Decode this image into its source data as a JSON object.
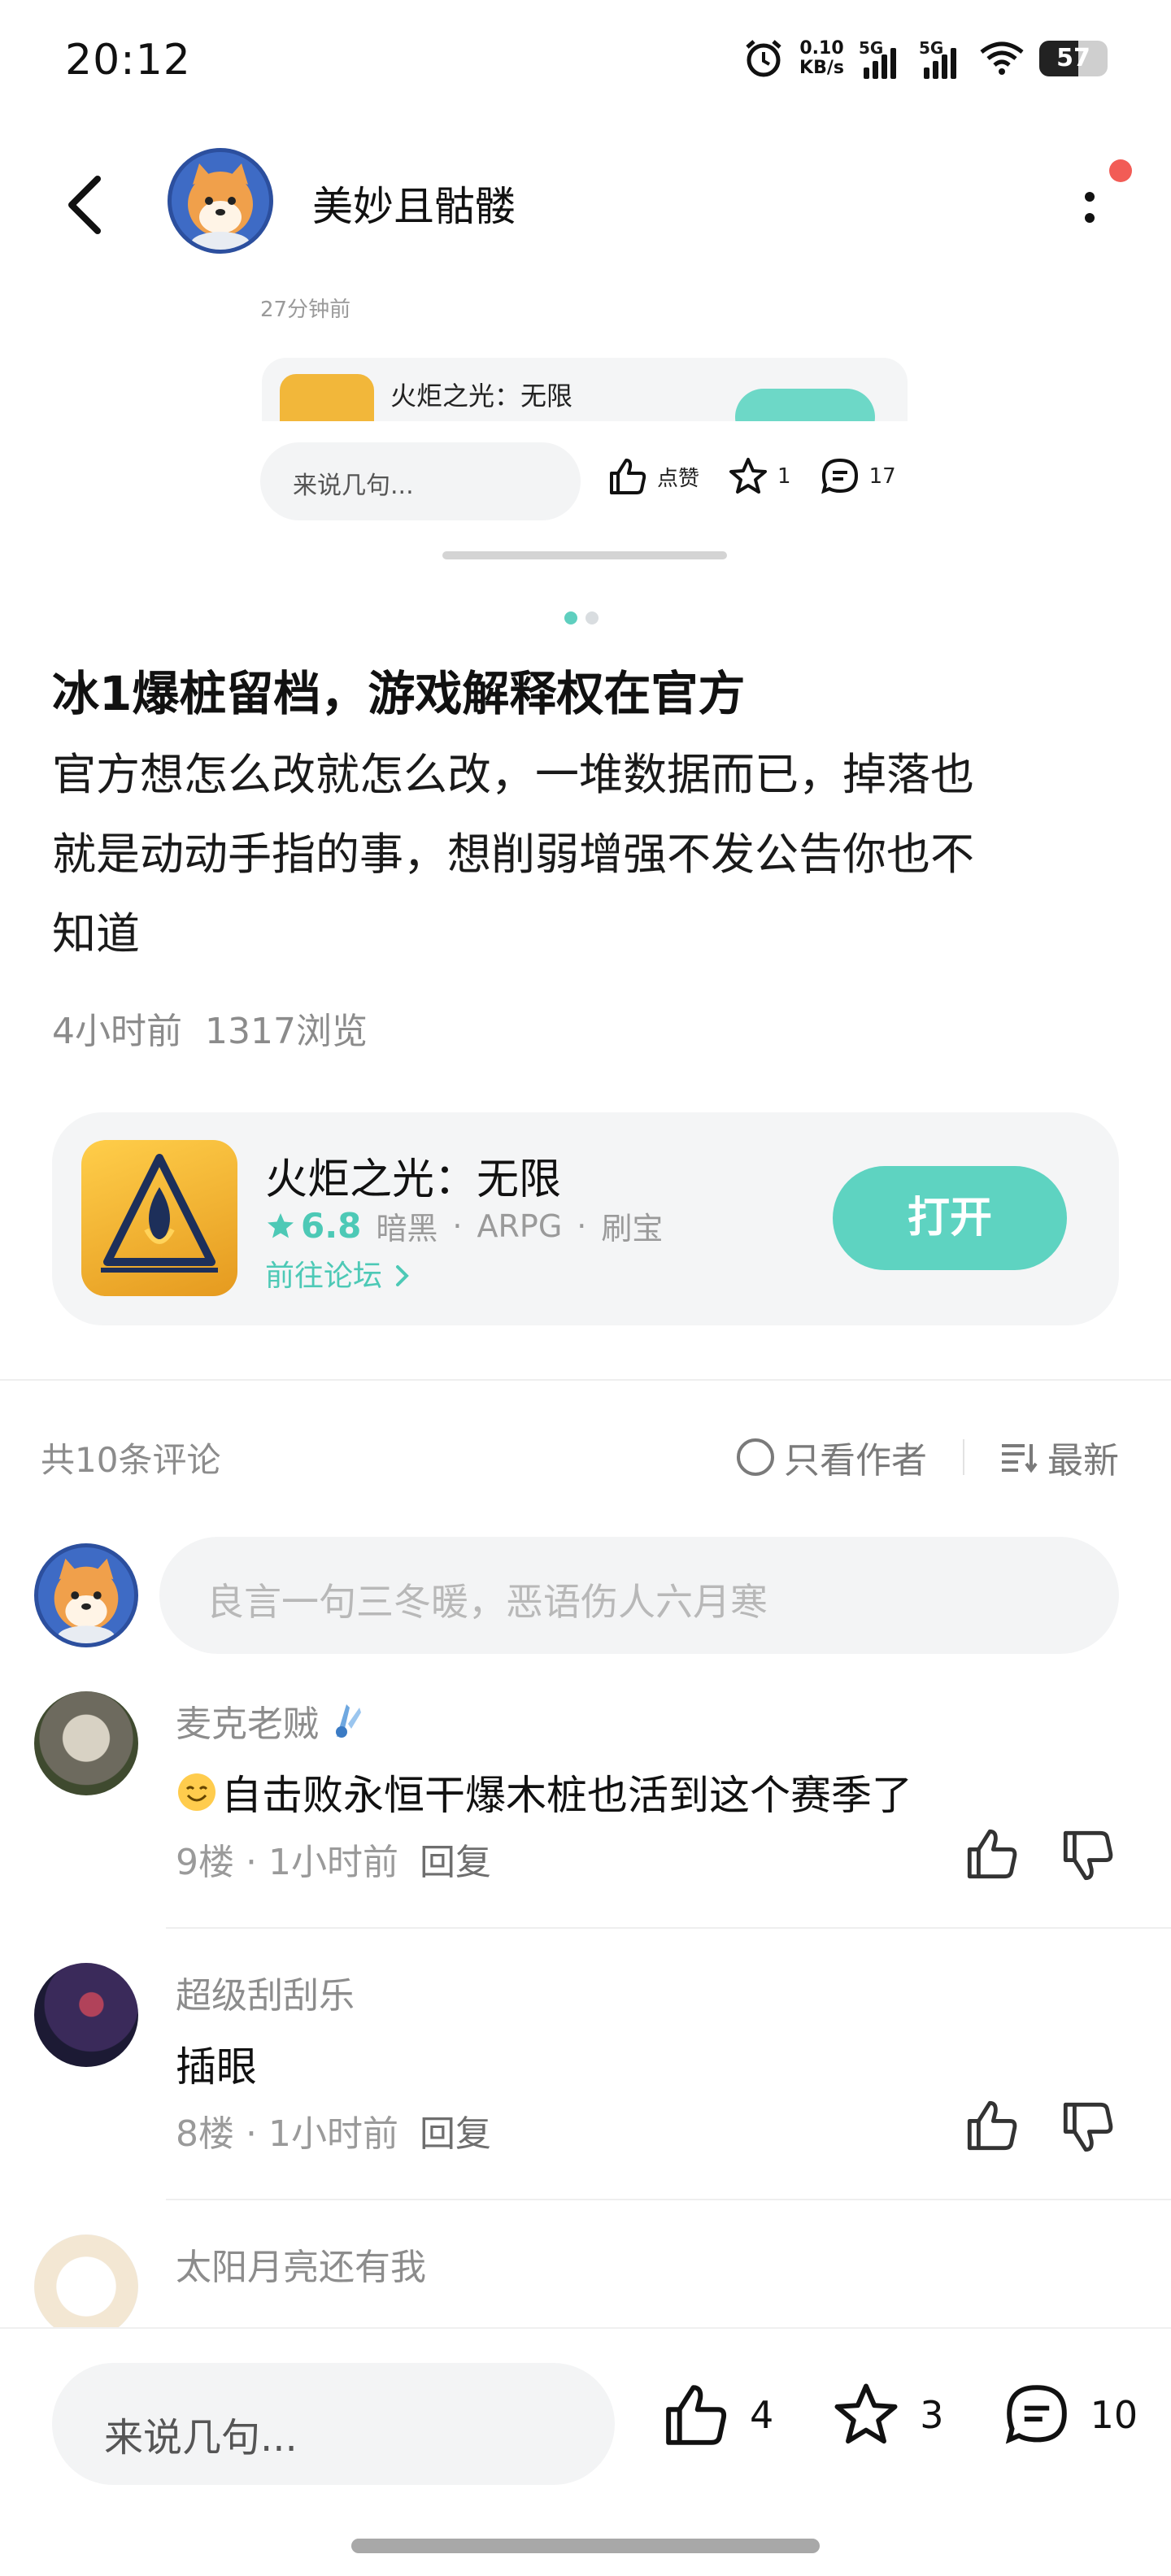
{
  "status_bar": {
    "time": "20:12",
    "net_speed_value": "0.10",
    "net_speed_unit": "KB/s",
    "sim1": "5G",
    "sim2": "5G",
    "battery": "57"
  },
  "header": {
    "author_name": "美妙且骷髅"
  },
  "preview": {
    "time": "27分钟前",
    "game_title": "火炬之光：无限",
    "input_placeholder": "来说几句...",
    "like_label": "点赞",
    "star_count": "1",
    "comment_count": "17"
  },
  "post": {
    "title": "冰1爆桩留档，游戏解释权在官方",
    "body_lines": [
      "官方想怎么改就怎么改，一堆数据而已，掉落也",
      "就是动动手指的事，想削弱增强不发公告你也不",
      "知道"
    ],
    "time": "4小时前",
    "views": "1317浏览"
  },
  "game_card": {
    "name": "火炬之光：无限",
    "rating": "6.8",
    "tags": [
      "暗黑",
      "ARPG",
      "刷宝"
    ],
    "forum_link": "前往论坛",
    "open_button": "打开"
  },
  "comments_header": {
    "count": "共10条评论",
    "author_only": "只看作者",
    "sort": "最新"
  },
  "comment_input": {
    "placeholder": "良言一句三冬暖，恶语伤人六月寒"
  },
  "comments": [
    {
      "name": "麦克老贼",
      "text": "自击败永恒干爆木桩也活到这个赛季了",
      "floor": "9楼",
      "time": "1小时前",
      "reply": "回复"
    },
    {
      "name": "超级刮刮乐",
      "text": "插眼",
      "floor": "8楼",
      "time": "1小时前",
      "reply": "回复"
    },
    {
      "name": "太阳月亮还有我"
    }
  ],
  "bottom_bar": {
    "input_placeholder": "来说几句...",
    "like_count": "4",
    "star_count": "3",
    "comment_count": "10"
  },
  "colors": {
    "accent": "#5ed3c1",
    "notification": "#f25c56",
    "card_bg": "#f4f5f6"
  }
}
